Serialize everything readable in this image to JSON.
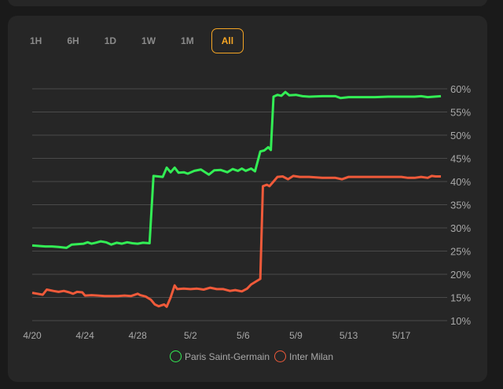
{
  "tabs": [
    {
      "label": "1H",
      "active": false
    },
    {
      "label": "6H",
      "active": false
    },
    {
      "label": "1D",
      "active": false
    },
    {
      "label": "1W",
      "active": false
    },
    {
      "label": "1M",
      "active": false
    },
    {
      "label": "All",
      "active": true
    }
  ],
  "colors": {
    "accent": "#f5a524",
    "psg": "#33ee55",
    "inter": "#f05a3a",
    "grid": "#4a4a4a"
  },
  "chart_data": {
    "type": "line",
    "x_labels": [
      "4/20",
      "4/24",
      "4/28",
      "5/2",
      "5/6",
      "5/9",
      "5/13",
      "5/17"
    ],
    "x_label_days": [
      0,
      4,
      8,
      12,
      16,
      20,
      24,
      28
    ],
    "x_range_days": [
      0,
      31
    ],
    "y_ticks": [
      10,
      15,
      20,
      25,
      30,
      35,
      40,
      45,
      50,
      55,
      60
    ],
    "y_tick_labels": [
      "10%",
      "15%",
      "20%",
      "25%",
      "30%",
      "35%",
      "40%",
      "45%",
      "50%",
      "55%",
      "60%"
    ],
    "ylim": [
      10,
      60
    ],
    "y_axis_position": "right",
    "grid": true,
    "legend_position": "bottom",
    "series": [
      {
        "name": "Paris Saint-Germain",
        "color": "#33ee55",
        "points": [
          [
            0.0,
            26.2
          ],
          [
            0.5,
            26.1
          ],
          [
            1.0,
            26.0
          ],
          [
            1.5,
            26.0
          ],
          [
            2.0,
            25.9
          ],
          [
            2.6,
            25.7
          ],
          [
            3.0,
            26.4
          ],
          [
            3.5,
            26.5
          ],
          [
            3.9,
            26.6
          ],
          [
            4.2,
            26.9
          ],
          [
            4.5,
            26.6
          ],
          [
            4.8,
            26.8
          ],
          [
            5.2,
            27.1
          ],
          [
            5.6,
            26.9
          ],
          [
            6.0,
            26.4
          ],
          [
            6.4,
            26.8
          ],
          [
            6.8,
            26.6
          ],
          [
            7.2,
            26.9
          ],
          [
            7.6,
            26.7
          ],
          [
            8.0,
            26.6
          ],
          [
            8.4,
            26.8
          ],
          [
            8.9,
            26.7
          ],
          [
            9.2,
            41.2
          ],
          [
            9.9,
            41.0
          ],
          [
            10.2,
            43.0
          ],
          [
            10.5,
            42.0
          ],
          [
            10.8,
            43.0
          ],
          [
            11.1,
            41.9
          ],
          [
            11.5,
            42.0
          ],
          [
            11.8,
            41.7
          ],
          [
            12.3,
            42.3
          ],
          [
            12.8,
            42.6
          ],
          [
            13.4,
            41.5
          ],
          [
            13.8,
            42.4
          ],
          [
            14.3,
            42.5
          ],
          [
            14.8,
            42.0
          ],
          [
            15.2,
            42.7
          ],
          [
            15.6,
            42.3
          ],
          [
            15.9,
            42.8
          ],
          [
            16.2,
            42.3
          ],
          [
            16.6,
            42.8
          ],
          [
            16.9,
            42.2
          ],
          [
            17.3,
            46.5
          ],
          [
            17.6,
            46.7
          ],
          [
            17.9,
            47.4
          ],
          [
            18.1,
            46.8
          ],
          [
            18.3,
            58.3
          ],
          [
            18.6,
            58.7
          ],
          [
            18.9,
            58.5
          ],
          [
            19.2,
            59.3
          ],
          [
            19.5,
            58.6
          ],
          [
            20.0,
            58.7
          ],
          [
            20.5,
            58.4
          ],
          [
            21.0,
            58.3
          ],
          [
            22.0,
            58.4
          ],
          [
            23.0,
            58.4
          ],
          [
            23.4,
            58.0
          ],
          [
            24.0,
            58.2
          ],
          [
            25.0,
            58.2
          ],
          [
            26.0,
            58.2
          ],
          [
            27.0,
            58.3
          ],
          [
            28.0,
            58.3
          ],
          [
            29.0,
            58.3
          ],
          [
            29.5,
            58.4
          ],
          [
            30.0,
            58.2
          ],
          [
            30.5,
            58.3
          ],
          [
            31.0,
            58.4
          ]
        ]
      },
      {
        "name": "Inter Milan",
        "color": "#f05a3a",
        "points": [
          [
            0.0,
            16.0
          ],
          [
            0.4,
            15.8
          ],
          [
            0.8,
            15.6
          ],
          [
            1.1,
            16.7
          ],
          [
            1.6,
            16.4
          ],
          [
            2.0,
            16.2
          ],
          [
            2.4,
            16.4
          ],
          [
            2.8,
            16.1
          ],
          [
            3.1,
            15.8
          ],
          [
            3.4,
            16.2
          ],
          [
            3.8,
            16.1
          ],
          [
            4.0,
            15.4
          ],
          [
            4.5,
            15.5
          ],
          [
            5.0,
            15.4
          ],
          [
            5.5,
            15.3
          ],
          [
            6.0,
            15.3
          ],
          [
            6.5,
            15.3
          ],
          [
            7.0,
            15.4
          ],
          [
            7.5,
            15.3
          ],
          [
            8.0,
            15.8
          ],
          [
            8.2,
            15.5
          ],
          [
            8.6,
            15.2
          ],
          [
            9.0,
            14.5
          ],
          [
            9.3,
            13.5
          ],
          [
            9.6,
            13.1
          ],
          [
            10.0,
            13.5
          ],
          [
            10.2,
            13.0
          ],
          [
            10.5,
            15.0
          ],
          [
            10.8,
            17.6
          ],
          [
            11.0,
            16.8
          ],
          [
            11.5,
            16.9
          ],
          [
            12.0,
            16.8
          ],
          [
            12.5,
            16.9
          ],
          [
            13.0,
            16.7
          ],
          [
            13.5,
            17.1
          ],
          [
            14.0,
            16.8
          ],
          [
            14.5,
            16.8
          ],
          [
            15.0,
            16.4
          ],
          [
            15.4,
            16.6
          ],
          [
            15.9,
            16.3
          ],
          [
            16.3,
            16.9
          ],
          [
            16.6,
            17.8
          ],
          [
            17.0,
            18.5
          ],
          [
            17.3,
            19.0
          ],
          [
            17.5,
            39.0
          ],
          [
            17.8,
            39.3
          ],
          [
            18.0,
            39.0
          ],
          [
            18.3,
            40.0
          ],
          [
            18.6,
            41.0
          ],
          [
            19.0,
            41.1
          ],
          [
            19.4,
            40.5
          ],
          [
            19.8,
            41.2
          ],
          [
            20.3,
            41.0
          ],
          [
            21.0,
            41.0
          ],
          [
            22.0,
            40.8
          ],
          [
            23.0,
            40.8
          ],
          [
            23.5,
            40.5
          ],
          [
            24.0,
            41.0
          ],
          [
            25.0,
            41.0
          ],
          [
            26.0,
            41.0
          ],
          [
            27.0,
            41.0
          ],
          [
            28.0,
            41.0
          ],
          [
            28.5,
            40.8
          ],
          [
            29.0,
            40.8
          ],
          [
            29.5,
            41.0
          ],
          [
            30.0,
            40.8
          ],
          [
            30.3,
            41.2
          ],
          [
            30.6,
            41.1
          ],
          [
            31.0,
            41.1
          ]
        ]
      }
    ]
  }
}
